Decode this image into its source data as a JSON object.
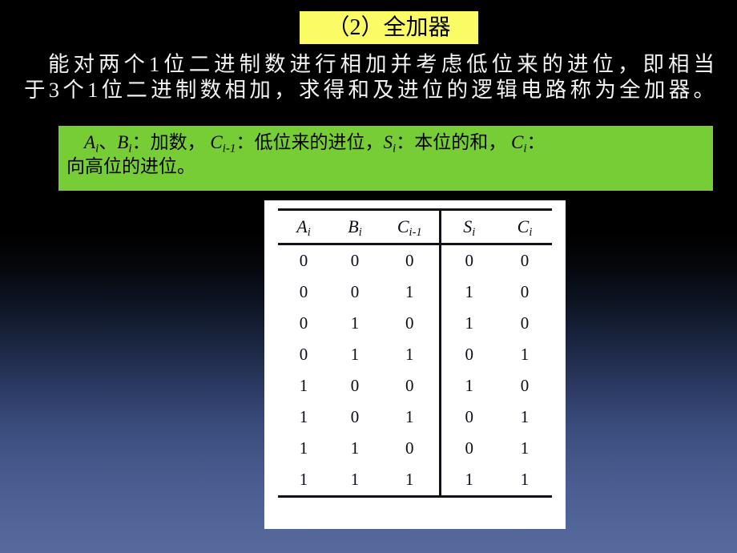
{
  "slide": {
    "title_banner": {
      "text": "（2）全加器",
      "background_color": "#fbfb66",
      "text_color": "#000000"
    },
    "description": {
      "line1": "能对两个1位二进制数进行相加并考虑低位来的进位，即相当",
      "line2": "于3个1位二进制数相加，求得和及进位的逻辑电路称为全加器。",
      "text_color": "#f2f2f2"
    },
    "definition_box": {
      "background_color": "#76cd36",
      "text_color": "#000000",
      "var_a": "A",
      "var_a_sub": "i",
      "sep1": "、",
      "var_b": "B",
      "var_b_sub": "i",
      "label_addends": "：加数，",
      "var_c_prev": "C",
      "var_c_prev_sub": "i-1",
      "label_carry_in": "：低位来的进位，",
      "var_s": "S",
      "var_s_sub": "i",
      "label_sum": "：本位的和，",
      "var_c": "C",
      "var_c_sub": "i",
      "label_carry_out_colon": "：",
      "line2": "向高位的进位。"
    },
    "background": {
      "top_color": "#000000",
      "bottom_color": "#57699d"
    }
  },
  "truth_table": {
    "panel_background": "#ffffff",
    "rule_color": "#111119",
    "headers": [
      {
        "base": "A",
        "sub": "i"
      },
      {
        "base": "B",
        "sub": "i"
      },
      {
        "base": "C",
        "sub": "i-1"
      },
      {
        "base": "S",
        "sub": "i"
      },
      {
        "base": "C",
        "sub": "i"
      }
    ],
    "input_columns": [
      "A_i",
      "B_i",
      "C_i-1"
    ],
    "output_columns": [
      "S_i",
      "C_i"
    ],
    "rows": [
      {
        "A": "0",
        "B": "0",
        "Cin": "0",
        "S": "0",
        "Cout": "0"
      },
      {
        "A": "0",
        "B": "0",
        "Cin": "1",
        "S": "1",
        "Cout": "0"
      },
      {
        "A": "0",
        "B": "1",
        "Cin": "0",
        "S": "1",
        "Cout": "0"
      },
      {
        "A": "0",
        "B": "1",
        "Cin": "1",
        "S": "0",
        "Cout": "1"
      },
      {
        "A": "1",
        "B": "0",
        "Cin": "0",
        "S": "1",
        "Cout": "0"
      },
      {
        "A": "1",
        "B": "0",
        "Cin": "1",
        "S": "0",
        "Cout": "1"
      },
      {
        "A": "1",
        "B": "1",
        "Cin": "0",
        "S": "0",
        "Cout": "1"
      },
      {
        "A": "1",
        "B": "1",
        "Cin": "1",
        "S": "1",
        "Cout": "1"
      }
    ]
  }
}
